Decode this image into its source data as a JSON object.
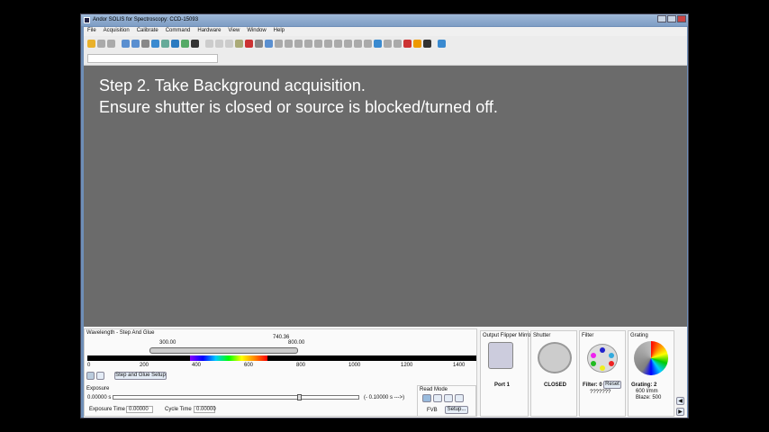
{
  "window": {
    "title": "Andor SOLIS for Spectroscopy: CCD-15093"
  },
  "menu": [
    "File",
    "Acquisition",
    "Calibrate",
    "Command",
    "Hardware",
    "View",
    "Window",
    "Help"
  ],
  "main": {
    "line1": "Step 2. Take Background acquisition.",
    "line2": "Ensure shutter is closed or source is blocked/turned off."
  },
  "wavelength": {
    "title": "Wavelength - Step And Glue",
    "start": "300.00",
    "center": "740.36",
    "end": "800.00",
    "ticks": [
      "0",
      "200",
      "400",
      "600",
      "800",
      "1000",
      "1200",
      "1400"
    ],
    "setup_button": "Step and Glue Setup"
  },
  "exposure": {
    "title": "Exposure",
    "min": "0.00000 s",
    "max": "(- 0.10000 s --->)",
    "exposure_time_label": "Exposure Time",
    "exposure_time": "0.00000",
    "cycle_time_label": "Cycle Time",
    "cycle_time": "0.00000"
  },
  "read_mode": {
    "title": "Read Mode",
    "mode": "FVB",
    "setup_button": "Setup..."
  },
  "flipper": {
    "title": "Output Flipper Mirror",
    "value": "Port 1"
  },
  "shutter": {
    "title": "Shutter",
    "value": "CLOSED"
  },
  "filter": {
    "title": "Filter",
    "value": "Filter: 0",
    "reset": "Reset",
    "name": "???????"
  },
  "grating": {
    "title": "Grating",
    "value": "Grating: 2",
    "lines": "600 l/mm",
    "blaze": "Blaze: 500"
  }
}
